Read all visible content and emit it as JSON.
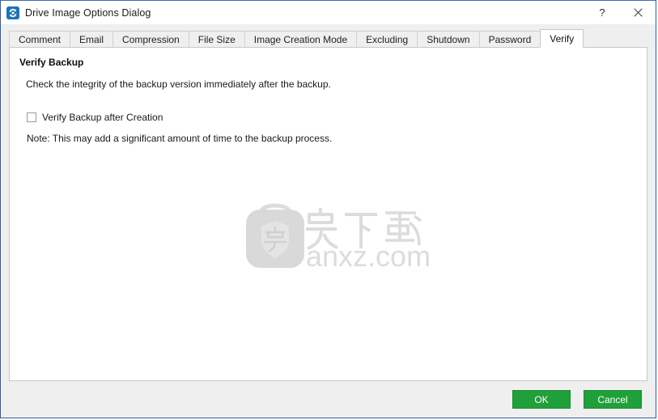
{
  "window": {
    "title": "Drive Image Options Dialog",
    "icon": "refresh-circular-arrows-icon",
    "help_label": "?",
    "close_label": "✕"
  },
  "tabs": [
    {
      "label": "Comment",
      "selected": false
    },
    {
      "label": "Email",
      "selected": false
    },
    {
      "label": "Compression",
      "selected": false
    },
    {
      "label": "File Size",
      "selected": false
    },
    {
      "label": "Image Creation Mode",
      "selected": false
    },
    {
      "label": "Excluding",
      "selected": false
    },
    {
      "label": "Shutdown",
      "selected": false
    },
    {
      "label": "Password",
      "selected": false
    },
    {
      "label": "Verify",
      "selected": true
    }
  ],
  "content": {
    "section_title": "Verify Backup",
    "description": "Check the integrity of the backup version immediately after the backup.",
    "checkbox": {
      "label": "Verify Backup after Creation",
      "checked": false
    },
    "note": "Note: This may add a significant amount of time to the backup process."
  },
  "watermark": {
    "shield_glyph": "安",
    "cn_text": "安下载",
    "domain_text": "anxz.com",
    "color": "#dcdcdc"
  },
  "footer": {
    "ok_label": "OK",
    "cancel_label": "Cancel",
    "button_color": "#20a03a"
  }
}
